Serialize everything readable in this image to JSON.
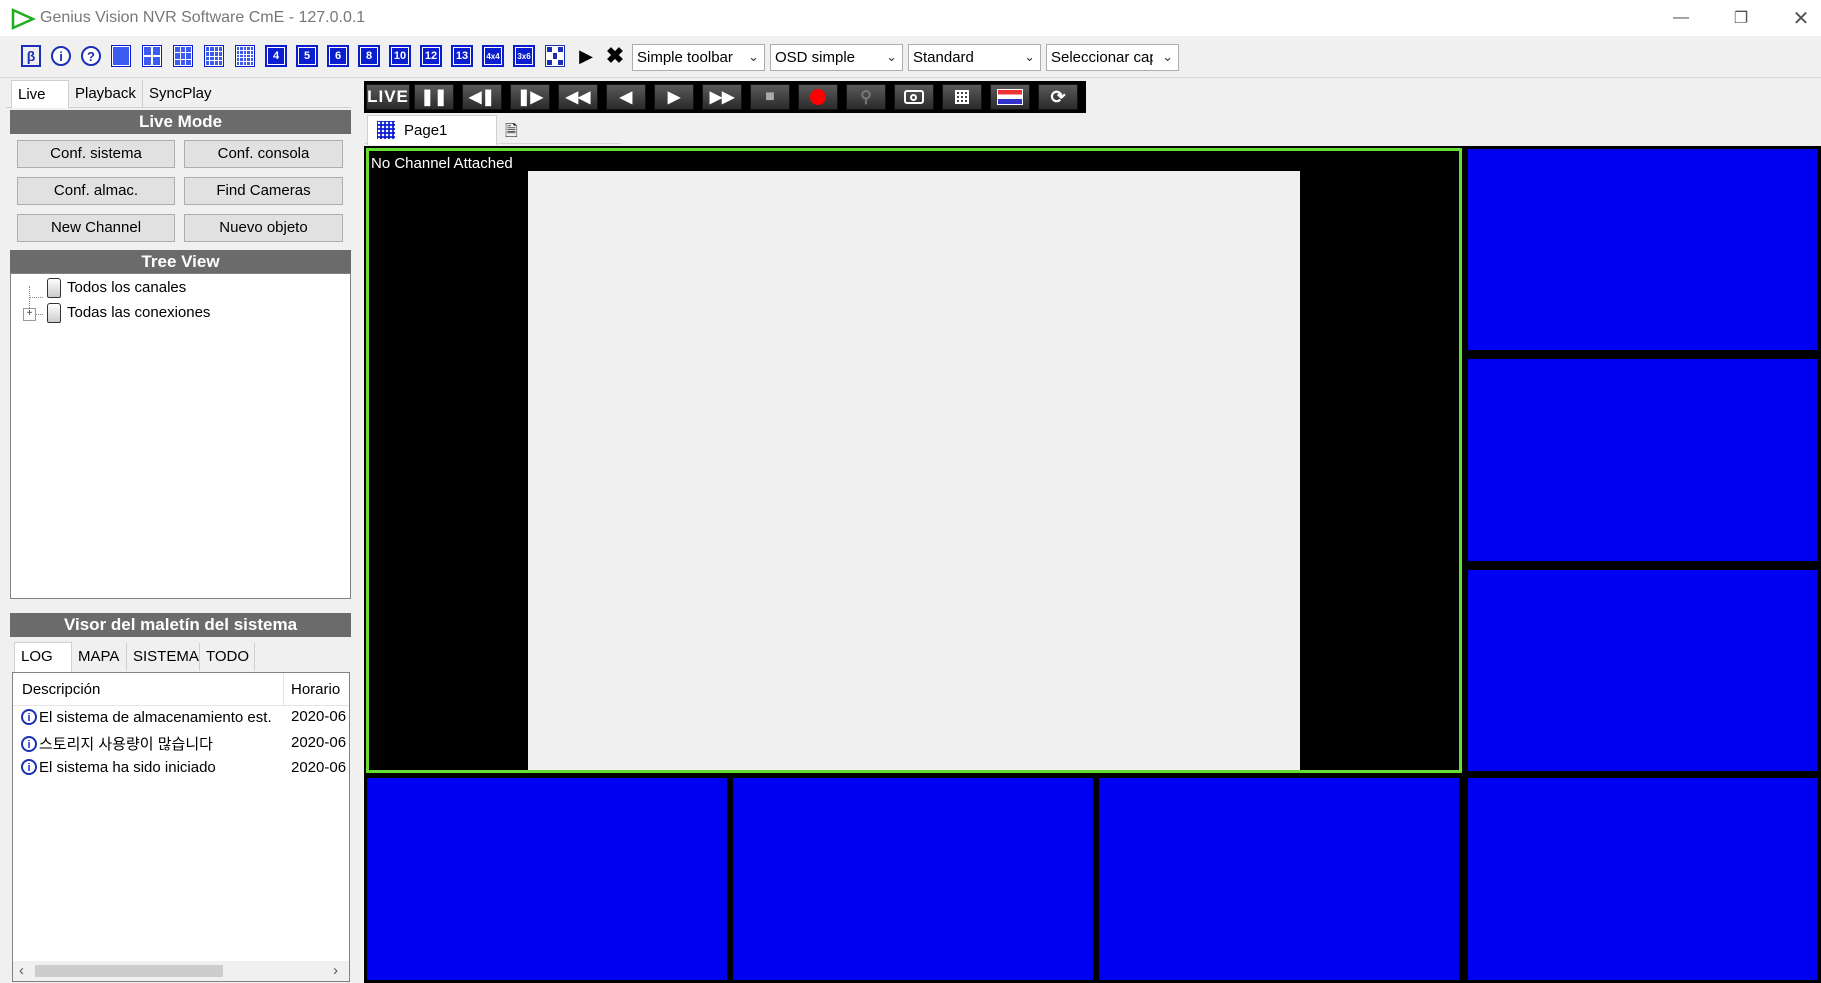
{
  "window": {
    "title": "Genius Vision NVR Software CmE - 127.0.0.1",
    "minimize_icon": "minimize-icon",
    "restore_icon": "restore-icon",
    "close_icon": "close-icon"
  },
  "toolbar": {
    "layout_numbers": [
      "4",
      "5",
      "6",
      "8",
      "10",
      "12",
      "13",
      "4x4",
      "3x6"
    ],
    "play_icon": "play-icon",
    "stop_icon": "x-icon",
    "toolbar_mode": "Simple toolbar",
    "osd_mode": "OSD simple",
    "stream_mode": "Standard",
    "layer_select": "Seleccionar capa"
  },
  "left_tabs": [
    "Live",
    "Playback",
    "SyncPlay"
  ],
  "live_mode": {
    "header": "Live Mode",
    "buttons": [
      "Conf. sistema",
      "Conf. consola",
      "Conf. almac.",
      "Find Cameras",
      "New Channel",
      "Nuevo objeto"
    ]
  },
  "tree_view": {
    "header": "Tree View",
    "items": [
      "Todos los canales",
      "Todas las conexiones"
    ]
  },
  "system_case": {
    "header": "Visor del maletín del sistema",
    "tabs": [
      "LOG",
      "MAPA",
      "SISTEMA",
      "TODO"
    ],
    "columns": [
      "Descripción",
      "Horario"
    ],
    "rows": [
      {
        "description": "El sistema de almacenamiento est...",
        "time": "2020-06"
      },
      {
        "description": "스토리지 사용량이 많습니다",
        "time": "2020-06"
      },
      {
        "description": "El sistema ha sido iniciado",
        "time": "2020-06"
      }
    ]
  },
  "player": {
    "live_label": "LIVE"
  },
  "pages": {
    "current": "Page1"
  },
  "main_channel": {
    "status": "No Channel Attached"
  },
  "colors": {
    "tile_blue": "#0000f0",
    "selected_border": "#66dd33",
    "record_red": "#ff0000"
  }
}
